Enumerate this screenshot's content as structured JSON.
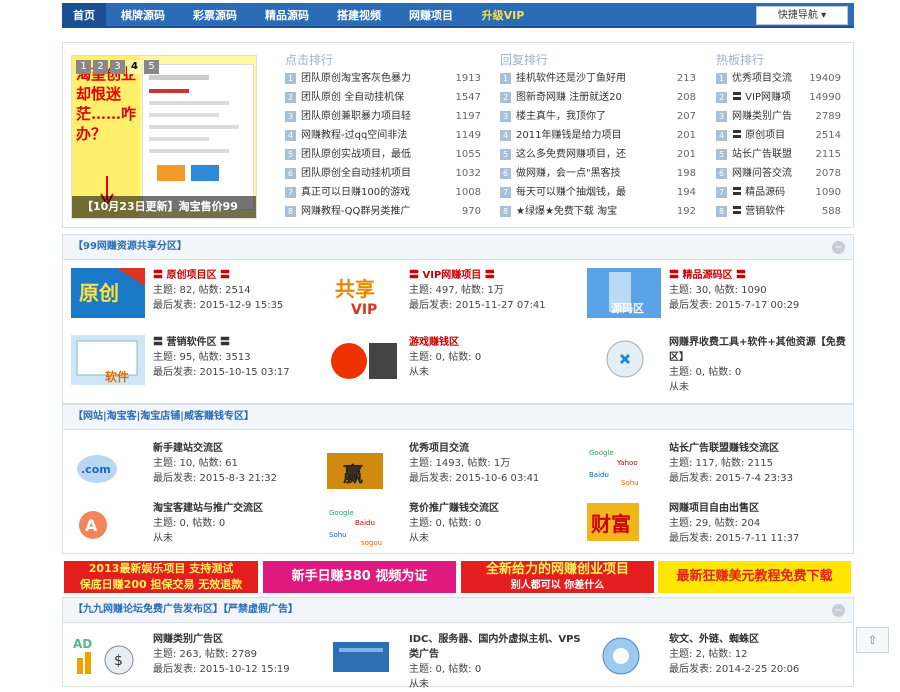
{
  "nav": {
    "items": [
      "首页",
      "棋牌源码",
      "彩票源码",
      "精品源码",
      "搭建视频",
      "网赚项目"
    ],
    "vip": "升级VIP",
    "quick": "快捷导航 ▾"
  },
  "slider": {
    "pages": [
      "1",
      "2",
      "3",
      "4",
      "5"
    ],
    "current": "4",
    "big_text": "渴望创业却恨迷茫……咋办？",
    "caption": "【10月23日更新】淘宝售价99"
  },
  "hot_points": {
    "title": "点击排行",
    "items": [
      {
        "n": "1",
        "t": "团队原创淘宝客灰色暴力",
        "v": "1913"
      },
      {
        "n": "2",
        "t": "团队原创 全自动挂机保",
        "v": "1547"
      },
      {
        "n": "3",
        "t": "团队原创兼职暴力项目轻",
        "v": "1197"
      },
      {
        "n": "4",
        "t": "网赚教程-过qq空间非法",
        "v": "1149"
      },
      {
        "n": "5",
        "t": "团队原创实战项目，最低",
        "v": "1055"
      },
      {
        "n": "6",
        "t": "团队原创全自动挂机项目",
        "v": "1032"
      },
      {
        "n": "7",
        "t": "真正可以日赚100的游戏",
        "v": "1008"
      },
      {
        "n": "8",
        "t": "网赚教程-QQ群另类推广",
        "v": "970"
      }
    ]
  },
  "hot_replies": {
    "title": "回复排行",
    "items": [
      {
        "n": "1",
        "t": "挂机软件还是沙丁鱼好用",
        "v": "213"
      },
      {
        "n": "2",
        "t": "图新奇网赚 注册就送20",
        "v": "208"
      },
      {
        "n": "3",
        "t": "楼主真牛，我顶你了",
        "v": "207"
      },
      {
        "n": "4",
        "t": "2011年赚钱是给力项目",
        "v": "201"
      },
      {
        "n": "5",
        "t": "这么多免费网赚项目，还",
        "v": "201"
      },
      {
        "n": "6",
        "t": "做网赚，会一点\"黑客技",
        "v": "198"
      },
      {
        "n": "7",
        "t": "每天可以赚个抽烟钱，最",
        "v": "194"
      },
      {
        "n": "8",
        "t": "★绿爆★免费下载 淘宝",
        "v": "192"
      }
    ]
  },
  "hot_boards": {
    "title": "热板排行",
    "items": [
      {
        "n": "1",
        "t": "优秀项目交流",
        "v": "19409"
      },
      {
        "n": "2",
        "t": "〓 VIP网赚项",
        "v": "14990"
      },
      {
        "n": "3",
        "t": "网赚类别广告",
        "v": "2789"
      },
      {
        "n": "4",
        "t": "〓 原创项目",
        "v": "2514"
      },
      {
        "n": "5",
        "t": "站长广告联盟",
        "v": "2115"
      },
      {
        "n": "6",
        "t": "网赚问答交流",
        "v": "2078"
      },
      {
        "n": "7",
        "t": "〓 精品源码",
        "v": "1090"
      },
      {
        "n": "8",
        "t": "〓 营销软件",
        "v": "588"
      }
    ]
  },
  "section1": {
    "title": "【99网赚资源共享分区】",
    "forums": [
      {
        "name": "〓 原创项目区 〓",
        "l1": "主题: 82, 帖数: 2514",
        "l2": "最后发表: 2015-12-9 15:35",
        "red": true,
        "icon": "原创"
      },
      {
        "name": "〓 VIP网赚项目 〓",
        "l1": "主题: 497, 帖数: 1万",
        "l2": "最后发表: 2015-11-27 07:41",
        "red": true,
        "icon": "共享"
      },
      {
        "name": "〓 精品源码区 〓",
        "l1": "主题: 30, 帖数: 1090",
        "l2": "最后发表: 2015-7-17 00:29",
        "red": true,
        "icon": "源码区"
      },
      {
        "name": "〓 营销软件区 〓",
        "l1": "主题: 95, 帖数: 3513",
        "l2": "最后发表: 2015-10-15 03:17",
        "red": false,
        "icon": "软件"
      },
      {
        "name": "游戏赚钱区",
        "l1": "主题: 0, 帖数: 0",
        "l2": "从未",
        "red": true,
        "icon": "游戏"
      },
      {
        "name": "网赚界收费工具+软件+其他资源【免费区】",
        "l1": "主题: 0, 帖数: 0",
        "l2": "从未",
        "red": false,
        "icon": ""
      }
    ]
  },
  "section2": {
    "title": "【网站|淘宝客|淘宝店铺|威客赚钱专区】",
    "forums": [
      {
        "name": "新手建站交流区",
        "l1": "主题: 10, 帖数: 61",
        "l2": "最后发表: 2015-8-3 21:32",
        "icon": ".com"
      },
      {
        "name": "优秀项目交流",
        "l1": "主题: 1493, 帖数: 1万",
        "l2": "最后发表: 2015-10-6 03:41",
        "icon": "赢"
      },
      {
        "name": "站长广告联盟赚钱交流区",
        "l1": "主题: 117, 帖数: 2115",
        "l2": "最后发表: 2015-7-4 23:33",
        "icon": "ads"
      },
      {
        "name": "淘宝客建站与推广交流区",
        "l1": "主题: 0, 帖数: 0",
        "l2": "从未",
        "icon": "A"
      },
      {
        "name": "竞价推广赚钱交流区",
        "l1": "主题: 0, 帖数: 0",
        "l2": "从未",
        "icon": "ads2"
      },
      {
        "name": "网赚项目自由出售区",
        "l1": "主题: 29, 帖数: 204",
        "l2": "最后发表: 2015-7-11 11:37",
        "icon": "财富"
      }
    ]
  },
  "ads": [
    {
      "line1": "2013最新娱乐项目 支持测试",
      "line2": "保底日赚200 担保交易 无效退款"
    },
    {
      "line1": "新手日赚380  视频为证",
      "line2": ""
    },
    {
      "line1": "全新给力的网赚创业项目",
      "line2": "别人都可以 你差什么"
    },
    {
      "line1": "最新狂赚美元教程免费下载",
      "line2": ""
    }
  ],
  "section3": {
    "title": "【九九网赚论坛免费广告发布区】【严禁虚假广告】",
    "forums": [
      {
        "name": "网赚类别广告区",
        "l1": "主题: 263, 帖数: 2789",
        "l2": "最后发表: 2015-10-12 15:19",
        "icon": "AD"
      },
      {
        "name": "IDC、服务器、国内外虚拟主机、VPS类广告",
        "l1": "主题: 0, 帖数: 0",
        "l2": "从未",
        "icon": "srv"
      },
      {
        "name": "软文、外链、蜘蛛区",
        "l1": "主题: 2, 帖数: 12",
        "l2": "最后发表: 2014-2-25 20:06",
        "icon": "spider"
      }
    ]
  },
  "colors": {
    "nav": "#2b6cb6",
    "accent_red": "#c00"
  }
}
